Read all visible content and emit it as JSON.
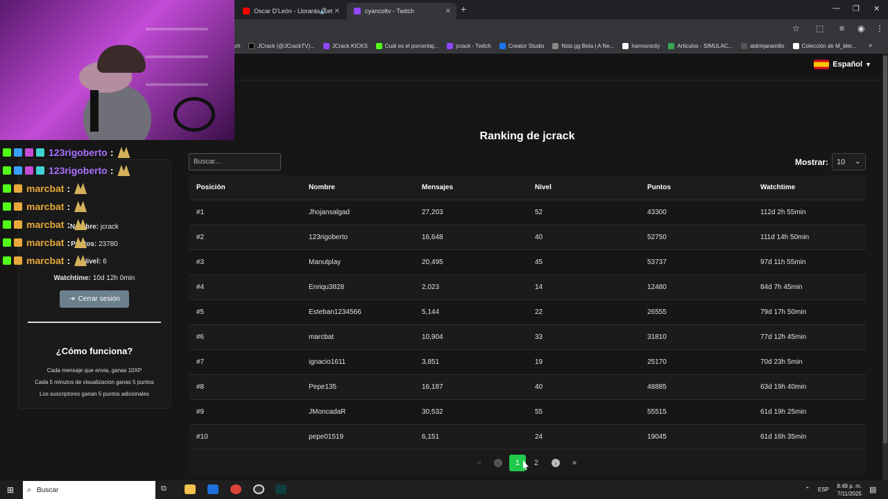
{
  "browser": {
    "tabs": [
      {
        "title": "Oscar D'León - Llorarás (Let",
        "favicon_color": "#ff0000"
      },
      {
        "title": "cyancoltv - Twitch",
        "favicon_color": "#9146ff"
      }
    ],
    "new_tab": "+",
    "bookmarks": [
      {
        "label": "ch",
        "color": "#9146ff"
      },
      {
        "label": "JCrack (@JCrackTV)...",
        "color": "#000000"
      },
      {
        "label": "JCrack KICKS",
        "color": "#9146ff"
      },
      {
        "label": "Cuál es el porcentaj...",
        "color": "#53fc18"
      },
      {
        "label": "jcrack - Twitch",
        "color": "#9146ff"
      },
      {
        "label": "Creator Studio",
        "color": "#1877f2"
      },
      {
        "label": "Noiz.gg Beta | A Ne...",
        "color": "#888888"
      },
      {
        "label": "harmonicity",
        "color": "#ffffff"
      },
      {
        "label": "Articulos - SIMULAC...",
        "color": "#34a853"
      },
      {
        "label": "aldrinjaramillo",
        "color": "#555555"
      },
      {
        "label": "Colección de M_blei...",
        "color": "#ffffff"
      }
    ]
  },
  "header": {
    "language": "Español"
  },
  "user": {
    "name_label": "Nombre:",
    "name": "jcrack",
    "points_label": "Puntos:",
    "points": "23780",
    "level_label": "Nivel:",
    "level": "6",
    "watchtime_label": "Watchtime:",
    "watchtime": "10d 12h 0min",
    "logout_label": "Cerrar sesión"
  },
  "how": {
    "title": "¿Cómo funciona?",
    "lines": [
      "Cada mensaje que envia, ganas 10XP",
      "Cada 5 minutos de visualizacion ganas 5 puntos",
      "Los suscriptores ganan 5 puntos adicionales"
    ]
  },
  "chat": [
    {
      "user": "123rigoberto",
      "color": "#a970ff"
    },
    {
      "user": "123rigoberto",
      "color": "#a970ff"
    },
    {
      "user": "marcbat",
      "color": "#e8a93a"
    },
    {
      "user": "marcbat",
      "color": "#e8a93a"
    },
    {
      "user": "marcbat",
      "color": "#e8a93a"
    },
    {
      "user": "marcbat",
      "color": "#e8a93a"
    },
    {
      "user": "marcbat",
      "color": "#e8a93a"
    }
  ],
  "ranking": {
    "title": "Ranking de jcrack",
    "search_placeholder": "Buscar...",
    "show_label": "Mostrar:",
    "show_value": "10",
    "headers": [
      "Posición",
      "Nombre",
      "Mensajes",
      "Nivel",
      "Puntos",
      "Watchtime"
    ],
    "rows": [
      [
        "#1",
        "Jhojansalgad",
        "27,203",
        "52",
        "43300",
        "112d 2h 55min"
      ],
      [
        "#2",
        "123rigoberto",
        "16,648",
        "40",
        "52750",
        "111d 14h 50min"
      ],
      [
        "#3",
        "Manutplay",
        "20,495",
        "45",
        "53737",
        "97d 11h 55min"
      ],
      [
        "#4",
        "Enriqu3828",
        "2,023",
        "14",
        "12480",
        "84d 7h 45min"
      ],
      [
        "#5",
        "Esteban1234566",
        "5,144",
        "22",
        "26555",
        "79d 17h 50min"
      ],
      [
        "#6",
        "marcbat",
        "10,904",
        "33",
        "31810",
        "77d 12h 45min"
      ],
      [
        "#7",
        "ignacio1611",
        "3,851",
        "19",
        "25170",
        "70d 23h 5min"
      ],
      [
        "#8",
        "Pepe135",
        "16,187",
        "40",
        "48885",
        "63d 19h 40min"
      ],
      [
        "#9",
        "JMoncadaR",
        "30,532",
        "55",
        "55515",
        "61d 19h 25min"
      ],
      [
        "#10",
        "pepe01519",
        "6,151",
        "24",
        "19045",
        "61d 16h 35min"
      ]
    ],
    "pages": [
      "1",
      "2"
    ],
    "current_page": "1"
  },
  "taskbar": {
    "search_label": "Buscar",
    "lang": "ESP",
    "time": "8:49 p. m.",
    "date": "7/11/2025"
  },
  "colors": {
    "accent_green": "#1ec94c",
    "logout_button": "#6c7f8c"
  }
}
